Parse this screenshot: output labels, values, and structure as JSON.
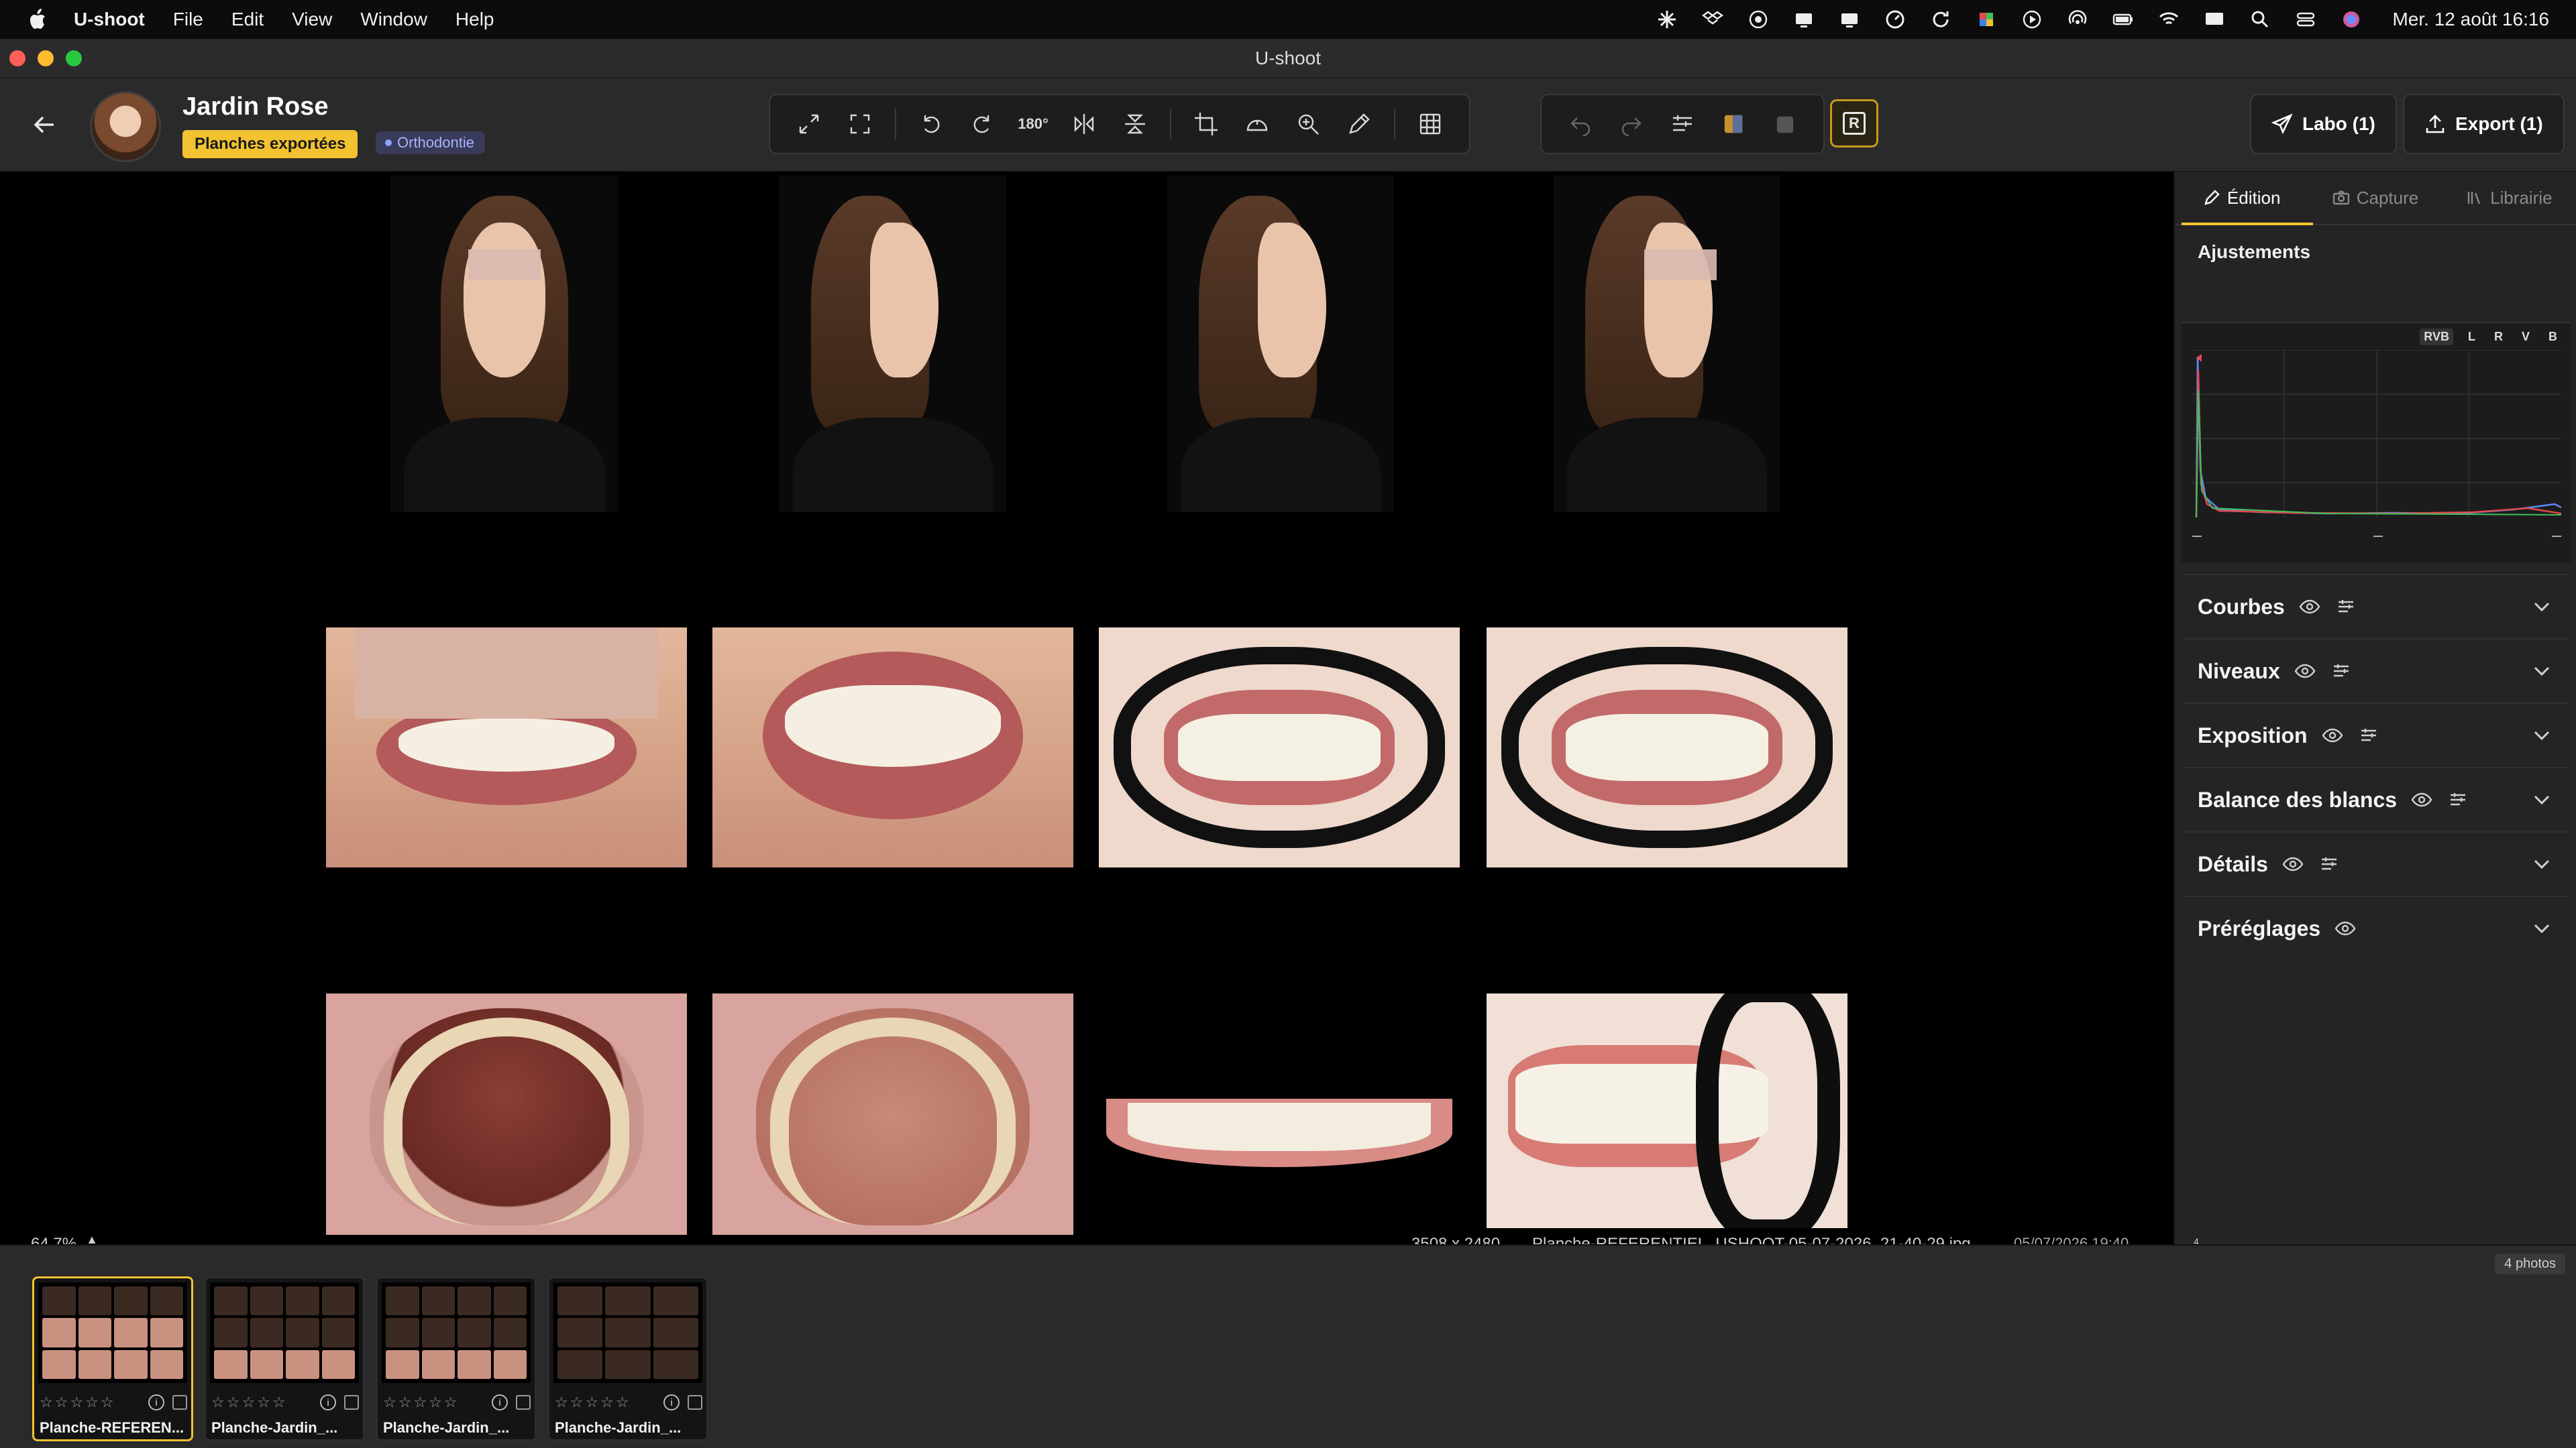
{
  "menubar": {
    "app_name": "U-shoot",
    "items": [
      "File",
      "Edit",
      "View",
      "Window",
      "Help"
    ],
    "clock": "Mer. 12 août  16:16"
  },
  "window": {
    "title": "U-shoot"
  },
  "header": {
    "patient_name": "Jardin Rose",
    "badge_exported": "Planches exportées",
    "badge_category": "Orthodontie",
    "tool_180": "180°",
    "labo_button": "Labo (1)",
    "export_button": "Export (1)",
    "r_button": "R"
  },
  "viewer": {
    "zoom": "64.7%",
    "dimensions": "3508 x 2480",
    "filename": "Planche-REFERENTIEL_USHOOT-05-07-2026_21-40-29.jpg",
    "date": "05/07/2026 19:40"
  },
  "panel": {
    "tabs": [
      "Édition",
      "Capture",
      "Librairie"
    ],
    "adjustments_title": "Ajustements",
    "histogram_channels": [
      "RVB",
      "L",
      "R",
      "V",
      "B"
    ],
    "sections": [
      "Courbes",
      "Niveaux",
      "Exposition",
      "Balance des blancs",
      "Détails",
      "Préréglages"
    ],
    "color_labels": [
      "#4a4a4a",
      "#e5484d",
      "#f07a2a",
      "#f2c230",
      "#3fbf5a",
      "#3f7ff0",
      "#9a5cf0"
    ],
    "label_count": "4"
  },
  "filmstrip": {
    "count": "4 photos",
    "thumbs": [
      {
        "name": "Planche-REFEREN..."
      },
      {
        "name": "Planche-Jardin_..."
      },
      {
        "name": "Planche-Jardin_..."
      },
      {
        "name": "Planche-Jardin_..."
      }
    ]
  },
  "colors": {
    "accent": "#f2c230",
    "category": "#a8b4ff"
  }
}
